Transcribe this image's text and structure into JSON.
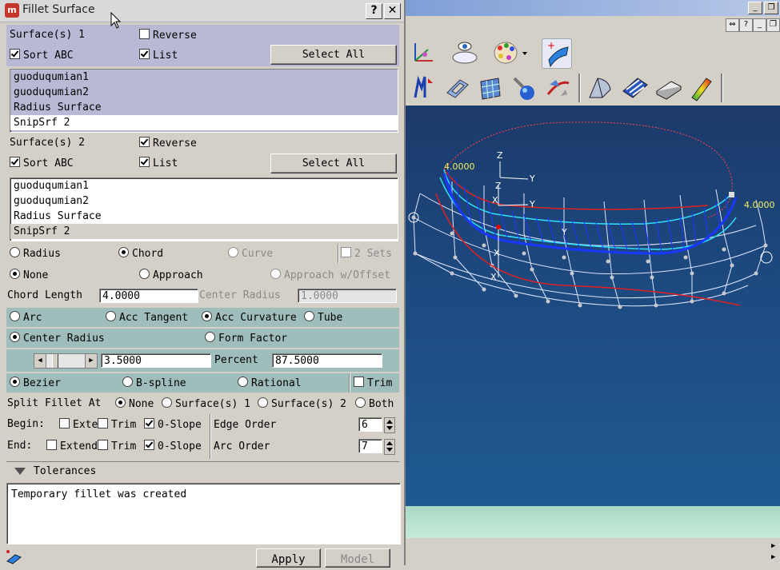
{
  "dialog": {
    "title": "Fillet Surface",
    "help_label": "?",
    "close_label": "✕",
    "surfaces1": {
      "label": "Surface(s) 1",
      "reverse_label": "Reverse",
      "reverse_checked": false,
      "sort_label": "Sort ABC",
      "sort_checked": true,
      "list_label": "List",
      "list_checked": true,
      "select_all_label": "Select All",
      "items": [
        "guoduqumian1",
        "guoduqumian2",
        "Radius Surface",
        "SnipSrf 2"
      ]
    },
    "surfaces2": {
      "label": "Surface(s) 2",
      "reverse_label": "Reverse",
      "reverse_checked": true,
      "sort_label": "Sort ABC",
      "sort_checked": true,
      "list_label": "List",
      "list_checked": true,
      "select_all_label": "Select All",
      "items": [
        "guoduqumian1",
        "guoduqumian2",
        "Radius Surface",
        "SnipSrf 2"
      ]
    },
    "fillet_type": {
      "radius": "Radius",
      "chord": "Chord",
      "curve": "Curve",
      "two_sets": "2 Sets",
      "selected": "Chord"
    },
    "approach": {
      "none": "None",
      "approach": "Approach",
      "approach_offset": "Approach w/Offset",
      "selected": "None"
    },
    "chord_length_label": "Chord Length",
    "chord_length_value": "4.0000",
    "center_radius_label": "Center Radius",
    "center_radius_value": "1.0000",
    "cross_section": {
      "arc": "Arc",
      "acc_tangent": "Acc Tangent",
      "acc_curvature": "Acc Curvature",
      "tube": "Tube",
      "selected": "Acc Curvature"
    },
    "shape_control": {
      "center_radius": "Center Radius",
      "form_factor": "Form Factor",
      "selected": "Center Radius"
    },
    "slider_value": "3.5000",
    "percent_label": "Percent",
    "percent_value": "87.5000",
    "surface_type": {
      "bezier": "Bezier",
      "bspline": "B-spline",
      "rational": "Rational",
      "trim": "Trim",
      "selected": "Bezier"
    },
    "split": {
      "label": "Split Fillet At",
      "none": "None",
      "s1": "Surface(s) 1",
      "s2": "Surface(s) 2",
      "both": "Both",
      "selected": "None"
    },
    "begin": {
      "label": "Begin:",
      "extend": "Exte",
      "trim": "Trim",
      "zero_slope": "0-Slope"
    },
    "end": {
      "label": "End:",
      "extend": "Extend",
      "trim": "Trim",
      "zero_slope": "0-Slope"
    },
    "edge_order_label": "Edge Order",
    "edge_order_value": "6",
    "arc_order_label": "Arc Order",
    "arc_order_value": "7",
    "tolerances_label": "Tolerances",
    "message": "Temporary fillet was created",
    "apply_label": "Apply",
    "model_label": "Model"
  },
  "viewport": {
    "dim_left": "4.0000",
    "dim_right": "4.0000",
    "axis_x": "X",
    "axis_y": "Y",
    "axis_z": "Z"
  },
  "colors": {
    "dialog_bg": "#d4d0c8",
    "surface_section": "#b9b9d6",
    "option_section": "#9fbdbb",
    "viewport_top": "#1c3a6a",
    "viewport_bottom": "#1f5a92",
    "fillet_blue": "#1030ff",
    "curve_red": "#d02020",
    "edge_cyan": "#30e0ff"
  }
}
